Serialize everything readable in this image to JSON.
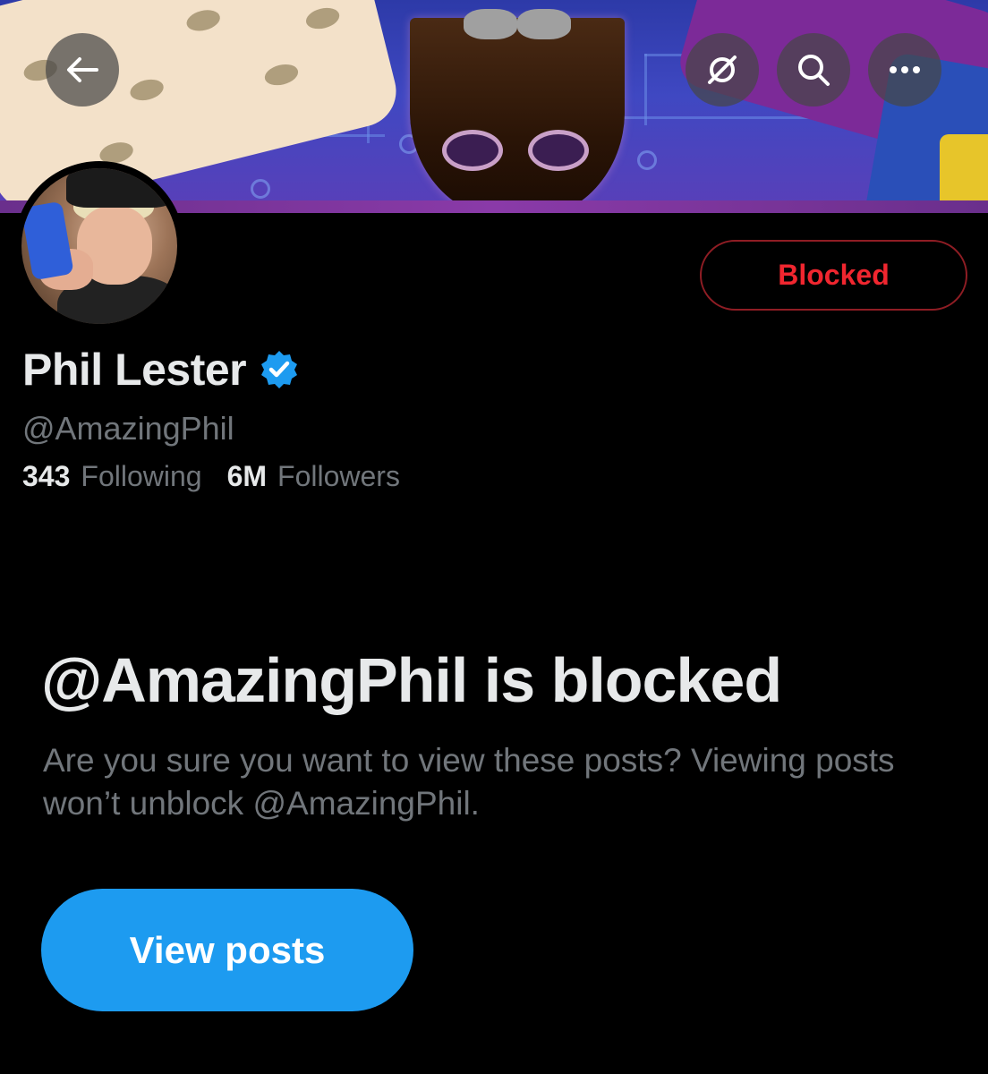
{
  "header": {
    "back_icon": "arrow-left-icon",
    "grok_icon": "grok-icon",
    "search_icon": "search-icon",
    "more_icon": "more-horizontal-icon"
  },
  "profile": {
    "display_name": "Phil Lester",
    "verified_icon": "verified-badge-icon",
    "handle": "@AmazingPhil",
    "following_count": "343",
    "following_label": "Following",
    "followers_count": "6M",
    "followers_label": "Followers",
    "relationship_button_label": "Blocked"
  },
  "blocked_notice": {
    "title": "@AmazingPhil is blocked",
    "description": "Are you sure you want to view these posts? Viewing posts won’t unblock @AmazingPhil.",
    "view_posts_label": "View posts"
  },
  "colors": {
    "background": "#000000",
    "primary_text": "#e7e9ea",
    "secondary_text": "#71767b",
    "accent_blue": "#1d9bf0",
    "blocked_red": "#f0262f",
    "blocked_border": "#8f1d24"
  }
}
